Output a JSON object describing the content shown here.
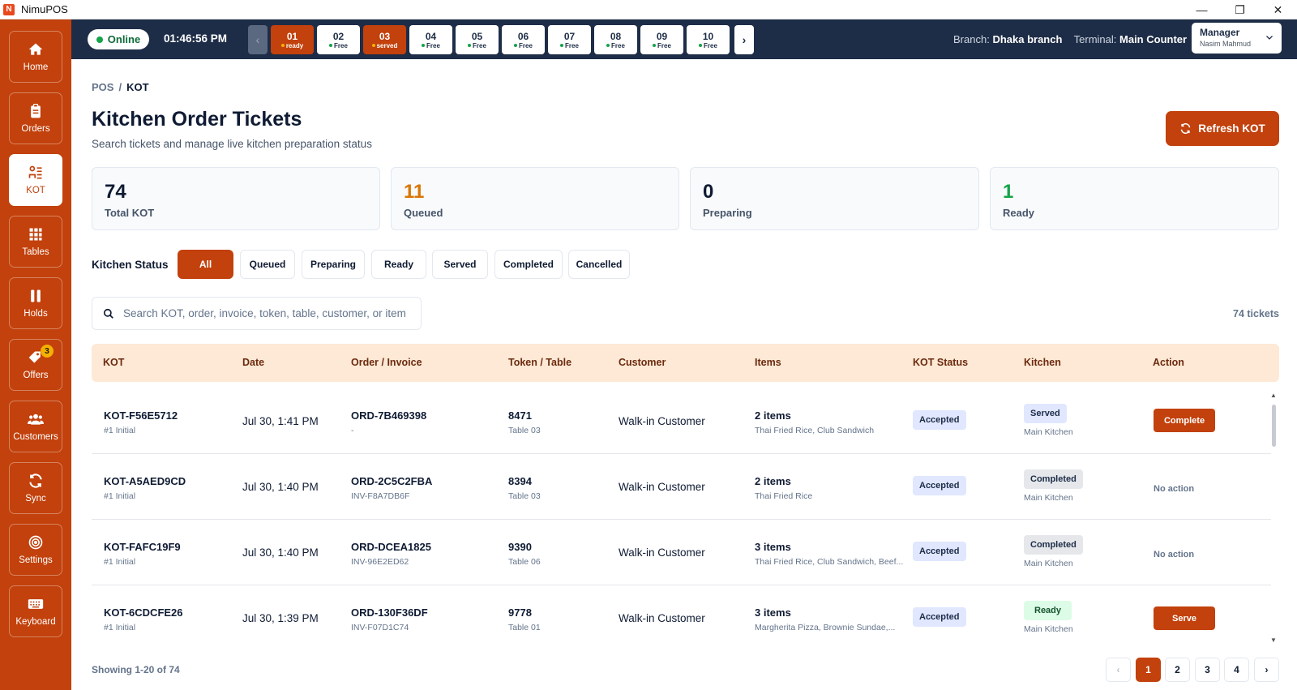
{
  "window": {
    "title": "NimuPOS",
    "logo_letter": "N",
    "min": "—",
    "max": "❐",
    "close": "✕"
  },
  "sidebar": {
    "items": [
      {
        "label": "Home",
        "icon": "home-icon"
      },
      {
        "label": "Orders",
        "icon": "clipboard-icon"
      },
      {
        "label": "KOT",
        "icon": "kot-icon",
        "active": true
      },
      {
        "label": "Tables",
        "icon": "grid-icon"
      },
      {
        "label": "Holds",
        "icon": "pause-icon"
      },
      {
        "label": "Offers",
        "icon": "tag-icon",
        "badge": "3"
      },
      {
        "label": "Customers",
        "icon": "users-icon"
      },
      {
        "label": "Sync",
        "icon": "sync-icon"
      },
      {
        "label": "Settings",
        "icon": "target-icon"
      },
      {
        "label": "Keyboard",
        "icon": "keyboard-icon"
      }
    ]
  },
  "topbar": {
    "status": "Online",
    "clock": "01:46:56 PM",
    "tables": [
      {
        "num": "01",
        "status": "ready",
        "busy": true
      },
      {
        "num": "02",
        "status": "Free"
      },
      {
        "num": "03",
        "status": "served",
        "busy": true
      },
      {
        "num": "04",
        "status": "Free"
      },
      {
        "num": "05",
        "status": "Free"
      },
      {
        "num": "06",
        "status": "Free"
      },
      {
        "num": "07",
        "status": "Free"
      },
      {
        "num": "08",
        "status": "Free"
      },
      {
        "num": "09",
        "status": "Free"
      },
      {
        "num": "10",
        "status": "Free"
      }
    ],
    "branch_label": "Branch:",
    "branch": "Dhaka branch",
    "terminal_label": "Terminal:",
    "terminal": "Main Counter",
    "user_role": "Manager",
    "user_name": "Nasim Mahmud"
  },
  "page": {
    "breadcrumb_root": "POS",
    "breadcrumb_sep": "/",
    "breadcrumb_current": "KOT",
    "title": "Kitchen Order Tickets",
    "subtitle": "Search tickets and manage live kitchen preparation status",
    "refresh_label": "Refresh KOT"
  },
  "stats": [
    {
      "value": "74",
      "label": "Total KOT",
      "color": "#0f1b33"
    },
    {
      "value": "11",
      "label": "Queued",
      "color": "#d97706"
    },
    {
      "value": "0",
      "label": "Preparing",
      "color": "#0f1b33"
    },
    {
      "value": "1",
      "label": "Ready",
      "color": "#16a34a"
    }
  ],
  "filters": {
    "label": "Kitchen Status",
    "options": [
      "All",
      "Queued",
      "Preparing",
      "Ready",
      "Served",
      "Completed",
      "Cancelled"
    ],
    "active": "All"
  },
  "search": {
    "placeholder": "Search KOT, order, invoice, token, table, customer, or item",
    "value": ""
  },
  "ticket_count": "74 tickets",
  "table": {
    "headers": [
      "KOT",
      "Date",
      "Order / Invoice",
      "Token / Table",
      "Customer",
      "Items",
      "KOT Status",
      "Kitchen",
      "Action"
    ],
    "rows": [
      {
        "kot": "KOT-F56E5712",
        "kot_sub": "#1 Initial",
        "date": "Jul 30, 1:41 PM",
        "order": "ORD-7B469398",
        "invoice": "-",
        "token": "8471",
        "table": "Table 03",
        "customer": "Walk-in Customer",
        "items": "2 items",
        "items_sub": "Thai Fried Rice, Club Sandwich",
        "kot_status": "Accepted",
        "kitchen_status": "Served",
        "kitchen_kind": "served",
        "kitchen_name": "Main Kitchen",
        "action": "Complete"
      },
      {
        "kot": "KOT-A5AED9CD",
        "kot_sub": "#1 Initial",
        "date": "Jul 30, 1:40 PM",
        "order": "ORD-2C5C2FBA",
        "invoice": "INV-F8A7DB6F",
        "token": "8394",
        "table": "Table 03",
        "customer": "Walk-in Customer",
        "items": "2 items",
        "items_sub": "Thai Fried Rice",
        "kot_status": "Accepted",
        "kitchen_status": "Completed",
        "kitchen_kind": "completed",
        "kitchen_name": "Main Kitchen",
        "action": "No action"
      },
      {
        "kot": "KOT-FAFC19F9",
        "kot_sub": "#1 Initial",
        "date": "Jul 30, 1:40 PM",
        "order": "ORD-DCEA1825",
        "invoice": "INV-96E2ED62",
        "token": "9390",
        "table": "Table 06",
        "customer": "Walk-in Customer",
        "items": "3 items",
        "items_sub": "Thai Fried Rice, Club Sandwich, Beef...",
        "kot_status": "Accepted",
        "kitchen_status": "Completed",
        "kitchen_kind": "completed",
        "kitchen_name": "Main Kitchen",
        "action": "No action"
      },
      {
        "kot": "KOT-6CDCFE26",
        "kot_sub": "#1 Initial",
        "date": "Jul 30, 1:39 PM",
        "order": "ORD-130F36DF",
        "invoice": "INV-F07D1C74",
        "token": "9778",
        "table": "Table 01",
        "customer": "Walk-in Customer",
        "items": "3 items",
        "items_sub": "Margherita Pizza, Brownie Sundae,...",
        "kot_status": "Accepted",
        "kitchen_status": "Ready",
        "kitchen_kind": "ready",
        "kitchen_name": "Main Kitchen",
        "action": "Serve"
      }
    ]
  },
  "pagination": {
    "showing": "Showing 1-20 of 74",
    "pages": [
      "1",
      "2",
      "3",
      "4"
    ],
    "current": "1",
    "prev": "‹",
    "next": "›"
  }
}
